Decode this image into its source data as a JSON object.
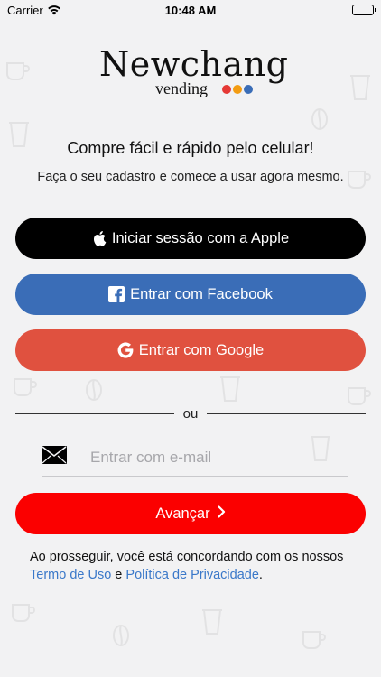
{
  "status_bar": {
    "carrier": "Carrier",
    "time": "10:48 AM"
  },
  "logo": {
    "brand": "Newchang",
    "sub": "vending",
    "dot_colors": [
      "#e53935",
      "#f39c12",
      "#3a6db7"
    ]
  },
  "headline": "Compre fácil e rápido pelo celular!",
  "subline": "Faça o seu cadastro e comece a usar agora mesmo.",
  "buttons": {
    "apple": {
      "label": "Iniciar sessão com a Apple",
      "icon": "apple-icon",
      "color": "#000000"
    },
    "facebook": {
      "label": "Entrar com Facebook",
      "icon": "facebook-icon",
      "color": "#3a6db7"
    },
    "google": {
      "label": "Entrar com Google",
      "icon": "google-icon",
      "color": "#e0513f"
    },
    "next": {
      "label": "Avançar",
      "icon": "chevron-right-icon",
      "color": "#fb0000"
    }
  },
  "divider": {
    "text": "ou"
  },
  "email": {
    "placeholder": "Entrar com e-mail",
    "value": "",
    "icon": "envelope-icon"
  },
  "legal": {
    "prefix": "Ao prosseguir, você está concordando com os nossos",
    "terms": "Termo de Uso",
    "and": "e",
    "privacy": "Política de Privacidade",
    "suffix": "."
  }
}
